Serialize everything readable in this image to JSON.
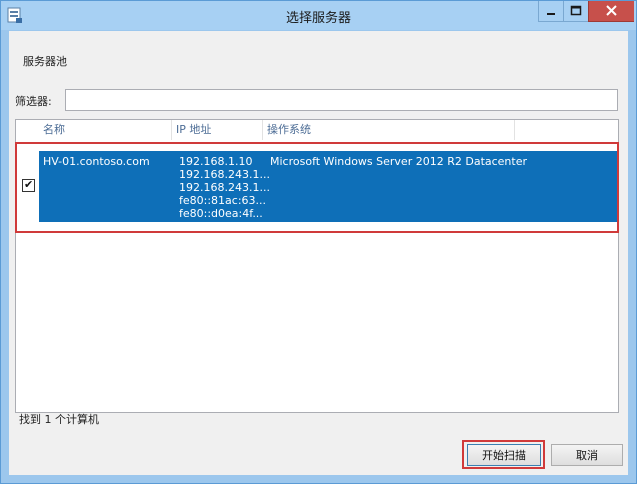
{
  "window": {
    "title": "选择服务器",
    "icons": {
      "app": "server-manager-icon",
      "minimize": "minimize-icon",
      "maximize": "maximize-icon",
      "close": "close-icon"
    }
  },
  "pool_label": "服务器池",
  "filter": {
    "label": "筛选器:",
    "value": ""
  },
  "columns": {
    "name": "名称",
    "ip": "IP 地址",
    "os": "操作系统"
  },
  "rows": [
    {
      "checked": true,
      "name": "HV-01.contoso.com",
      "ips": [
        "192.168.1.10",
        "192.168.243.1...",
        "192.168.243.1...",
        "fe80::81ac:63...",
        "fe80::d0ea:4f..."
      ],
      "os": "Microsoft Windows Server 2012 R2 Datacenter"
    }
  ],
  "status": "找到 1 个计算机",
  "buttons": {
    "scan": "开始扫描",
    "cancel": "取消"
  },
  "colors": {
    "selection": "#0e6fb8",
    "highlight": "#d03a3a",
    "close": "#c7504b"
  }
}
